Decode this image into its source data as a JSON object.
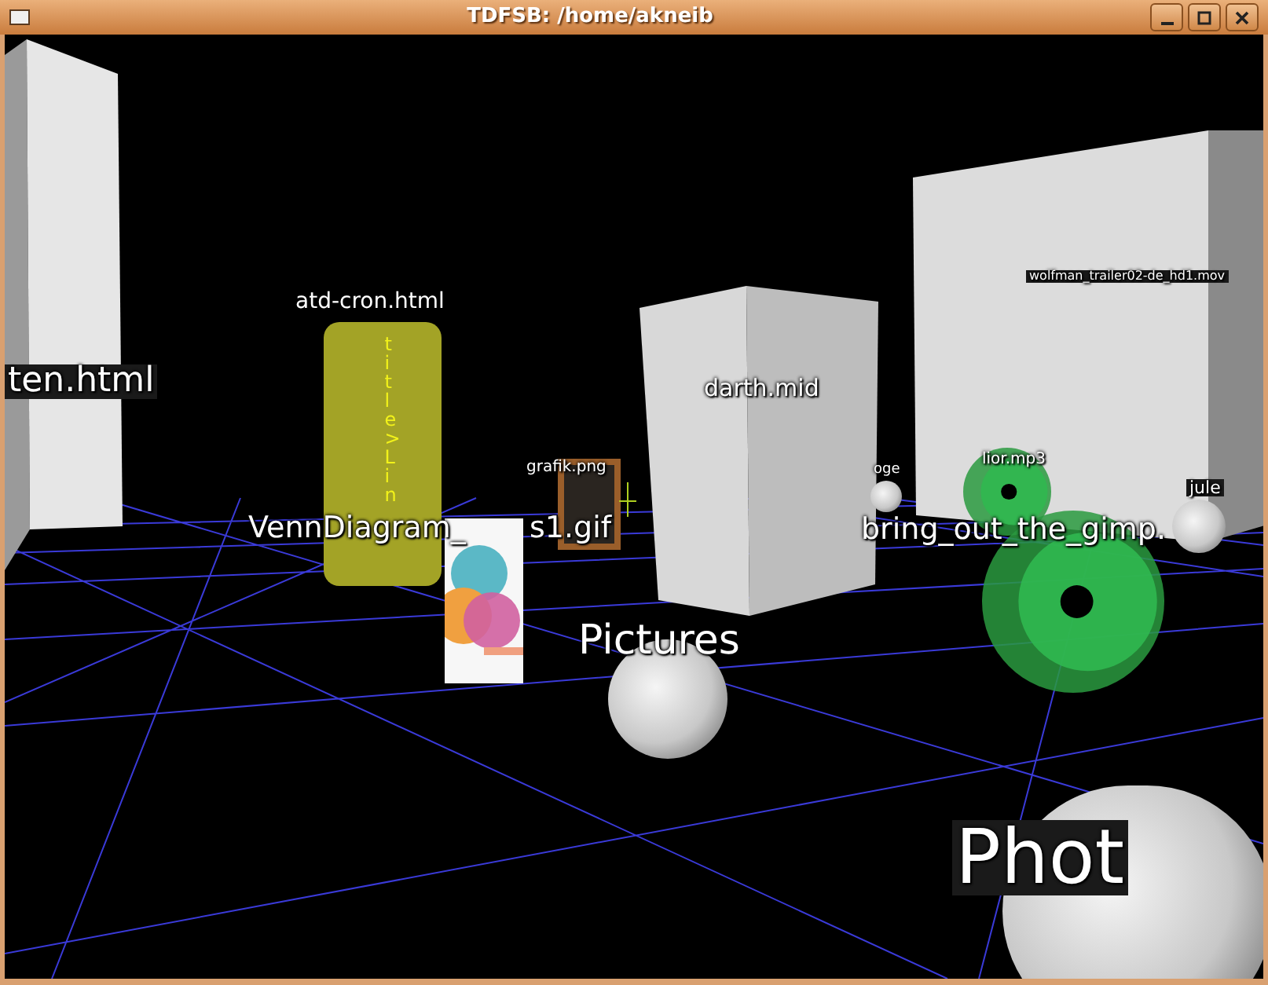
{
  "window": {
    "title": "TDFSB: /home/akneib"
  },
  "scene": {
    "objects": [
      {
        "kind": "block",
        "label": "ten.html"
      },
      {
        "kind": "cylinder",
        "label": "atd-cron.html",
        "content": "title>Lin"
      },
      {
        "kind": "picture",
        "label": "grafik.png"
      },
      {
        "kind": "card",
        "label": "VennDiagram_",
        "label_after": "s1.gif"
      },
      {
        "kind": "cube",
        "label": "darth.mid"
      },
      {
        "kind": "slab",
        "label": "wolfman_trailer02-de_hd1.mov"
      },
      {
        "kind": "sphere",
        "label": "oge"
      },
      {
        "kind": "disc",
        "label": "lior.mp3"
      },
      {
        "kind": "sphere",
        "label": "jule"
      },
      {
        "kind": "disc",
        "label": "bring_out_the_gimp."
      },
      {
        "kind": "sphere",
        "label": "Pictures"
      },
      {
        "kind": "sphere",
        "label": "Phot"
      }
    ]
  }
}
